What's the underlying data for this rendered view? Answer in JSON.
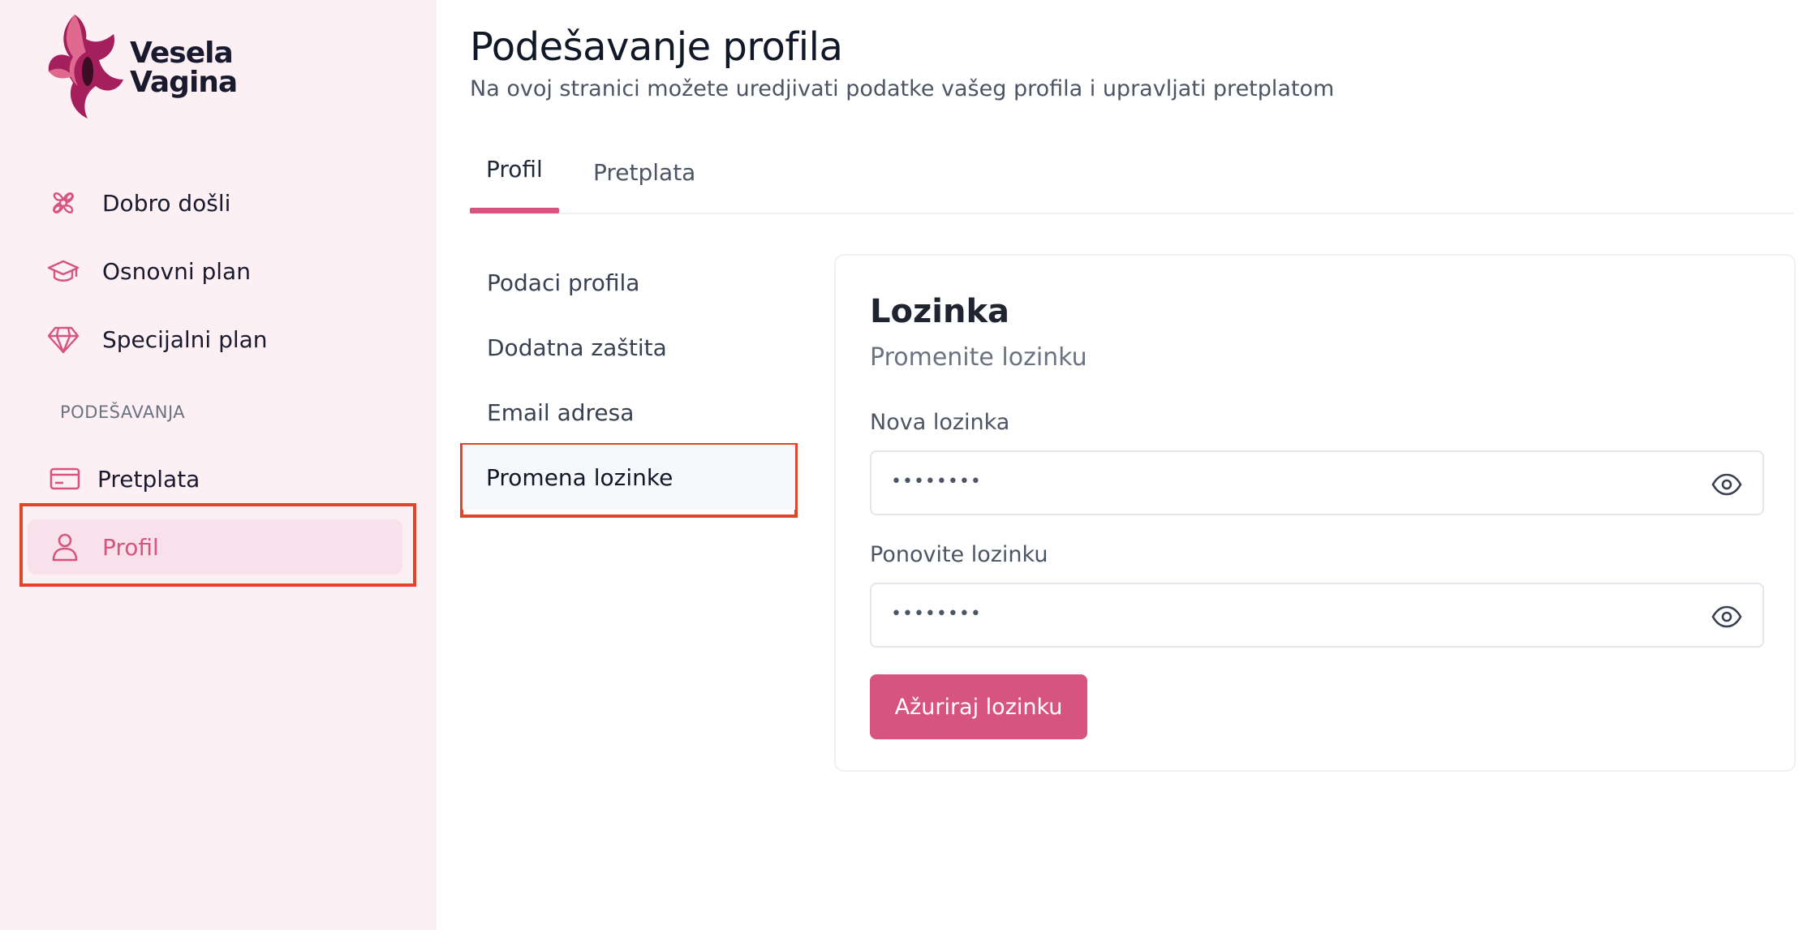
{
  "brand": {
    "line1": "Vesela",
    "line2": "Vagina",
    "accent": "#d6547f"
  },
  "sidebar": {
    "items": [
      {
        "label": "Dobro došli",
        "icon": "flower-icon"
      },
      {
        "label": "Osnovni plan",
        "icon": "graduation-cap-icon"
      },
      {
        "label": "Specijalni plan",
        "icon": "diamond-icon"
      }
    ],
    "section_label": "PODEŠAVANJA",
    "settings_items": [
      {
        "label": "Pretplata",
        "icon": "credit-card-icon"
      },
      {
        "label": "Profil",
        "icon": "user-icon",
        "active": true
      }
    ]
  },
  "header": {
    "title": "Podešavanje profila",
    "subtitle": "Na ovoj stranici možete uredjivati podatke vašeg profila i upravljati pretplatom"
  },
  "tabs": [
    {
      "label": "Profil",
      "active": true
    },
    {
      "label": "Pretplata",
      "active": false
    }
  ],
  "subnav": [
    {
      "label": "Podaci profila"
    },
    {
      "label": "Dodatna zaštita"
    },
    {
      "label": "Email adresa"
    },
    {
      "label": "Promena lozinke",
      "active": true
    }
  ],
  "card": {
    "title": "Lozinka",
    "subtitle": "Promenite lozinku",
    "new_password": {
      "label": "Nova lozinka",
      "value": "••••••••"
    },
    "repeat_password": {
      "label": "Ponovite lozinku",
      "value": "••••••••"
    },
    "submit_label": "Ažuriraj lozinku"
  },
  "colors": {
    "highlight": "#e0442a",
    "sidebar_bg": "#fcf0f5",
    "active_bg": "#f8e1ea"
  }
}
